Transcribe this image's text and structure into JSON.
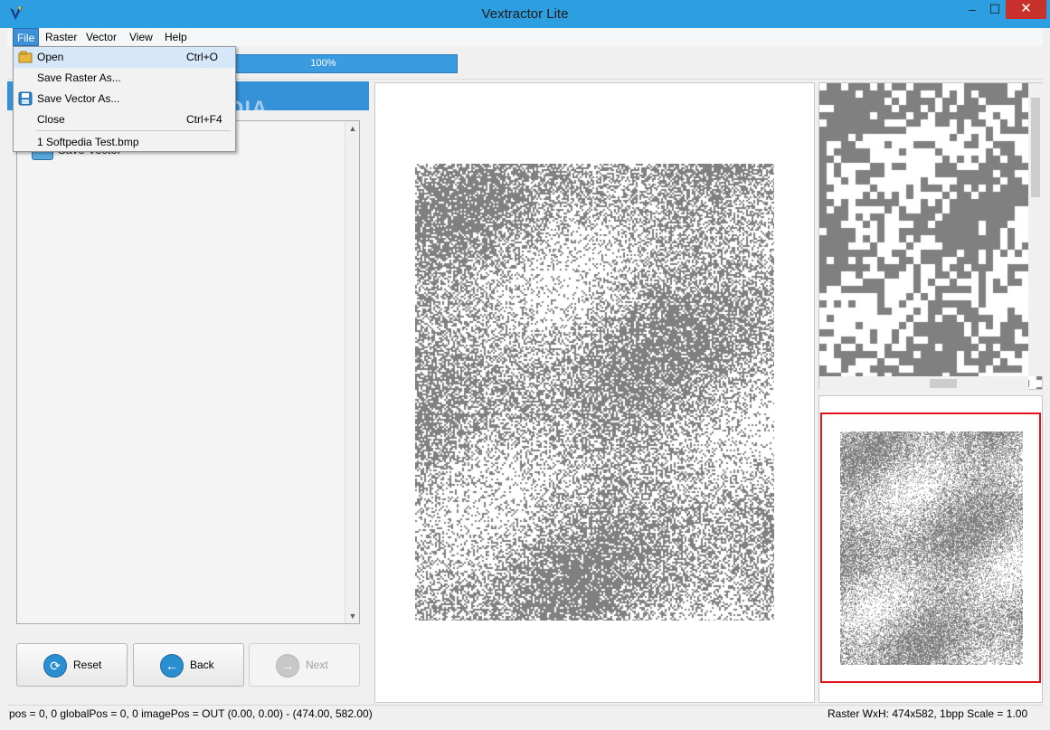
{
  "window": {
    "title": "Vextractor Lite",
    "min": "–",
    "max": "☐",
    "close": "✕"
  },
  "menu": {
    "file": "File",
    "raster": "Raster",
    "vector": "Vector",
    "view": "View",
    "help": "Help"
  },
  "file_menu": {
    "open": {
      "label": "Open",
      "shortcut": "Ctrl+O"
    },
    "save_raster": {
      "label": "Save Raster As..."
    },
    "save_vector": {
      "label": "Save Vector As..."
    },
    "close": {
      "label": "Close",
      "shortcut": "Ctrl+F4"
    },
    "recent": {
      "label": "1 Softpedia Test.bmp"
    }
  },
  "progress": {
    "text": "100%",
    "value": 1.0
  },
  "tree": {
    "item_label": "Save Vector",
    "scroll_up": "▲",
    "scroll_down": "▼"
  },
  "buttons": {
    "reset": "Reset",
    "back": "Back",
    "next": "Next"
  },
  "watermark": {
    "text": "SOFTPEDIA"
  },
  "status": {
    "left": "pos = 0, 0  globalPos = 0, 0  imagePos = OUT  (0.00, 0.00) - (474.00, 582.00)",
    "right": "Raster WxH: 474x582, 1bpp  Scale = 1.00"
  },
  "colors": {
    "accent": "#3591d8",
    "title_bar": "#2d9fe0",
    "close": "#c7302b",
    "preview_frame": "#e0141a",
    "raster_pixel": "#808080"
  },
  "icons": {
    "app": "vextractor-logo-icon",
    "open": "folder-open-icon",
    "save": "floppy-disk-icon",
    "reset": "refresh-icon",
    "back": "arrow-left-icon",
    "next": "arrow-right-icon"
  }
}
